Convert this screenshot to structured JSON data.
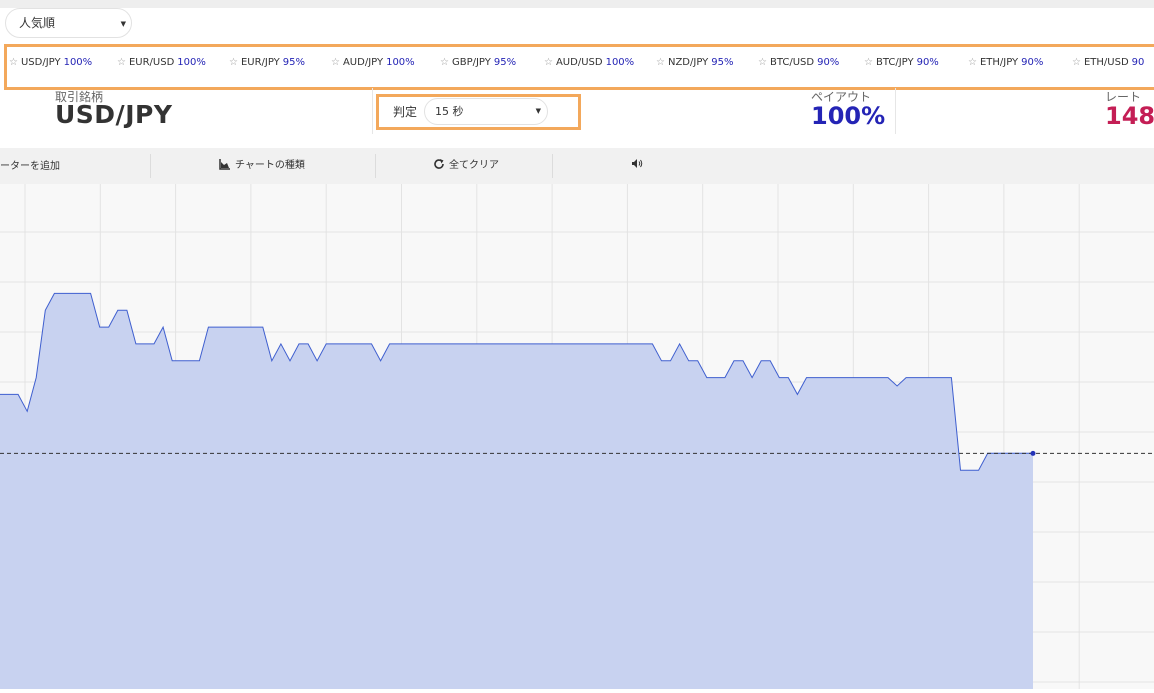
{
  "sort": {
    "label": "人気順"
  },
  "pairs": [
    {
      "name": "USD/JPY",
      "payout": "100%"
    },
    {
      "name": "EUR/USD",
      "payout": "100%"
    },
    {
      "name": "EUR/JPY",
      "payout": "95%"
    },
    {
      "name": "AUD/JPY",
      "payout": "100%"
    },
    {
      "name": "GBP/JPY",
      "payout": "95%"
    },
    {
      "name": "AUD/USD",
      "payout": "100%"
    },
    {
      "name": "NZD/JPY",
      "payout": "95%"
    },
    {
      "name": "BTC/USD",
      "payout": "90%"
    },
    {
      "name": "BTC/JPY",
      "payout": "90%"
    },
    {
      "name": "ETH/JPY",
      "payout": "90%"
    },
    {
      "name": "ETH/USD",
      "payout": "90"
    }
  ],
  "info": {
    "asset_label": "取引銘柄",
    "asset": "USD/JPY",
    "expiry_label": "判定",
    "expiry_value": "15 秒",
    "payout_label": "ペイアウト",
    "payout_value": "100%",
    "rate_label": "レート",
    "rate_value": "148."
  },
  "toolbar": {
    "indicator": "ーターを追加",
    "chart_type": "チャートの種類",
    "clear": "全てクリア"
  },
  "colors": {
    "accent_blue": "#2424b5",
    "rate_red": "#c41e55",
    "highlight_orange": "#f3a85b",
    "line_blue": "#3f5fcf",
    "area_fill": "#c8d2f0"
  },
  "chart_data": {
    "type": "area",
    "series": [
      {
        "values": [
          75,
          75,
          75,
          73,
          77,
          85,
          87,
          87,
          87,
          87,
          87,
          83,
          83,
          85,
          85,
          81,
          81,
          81,
          83,
          79,
          79,
          79,
          79,
          83,
          83,
          83,
          83,
          83,
          83,
          83,
          79,
          81,
          79,
          81,
          81,
          79,
          81,
          81,
          81,
          81,
          81,
          81,
          79,
          81,
          81,
          81,
          81,
          81,
          81,
          81,
          81,
          81,
          81,
          81,
          81,
          81,
          81,
          81,
          81,
          81,
          81,
          81,
          81,
          81,
          81,
          81,
          81,
          81,
          81,
          81,
          81,
          81,
          81,
          79,
          79,
          81,
          79,
          79,
          77,
          77,
          77,
          79,
          79,
          77,
          79,
          79,
          77,
          77,
          75,
          77,
          77,
          77,
          77,
          77,
          77,
          77,
          77,
          77,
          77,
          76,
          77,
          77,
          77,
          77,
          77,
          77,
          66,
          66,
          66,
          68,
          68,
          68,
          68,
          68,
          68
        ]
      }
    ],
    "current_value": 68,
    "ylim": [
      40,
      100
    ],
    "grid": true
  }
}
